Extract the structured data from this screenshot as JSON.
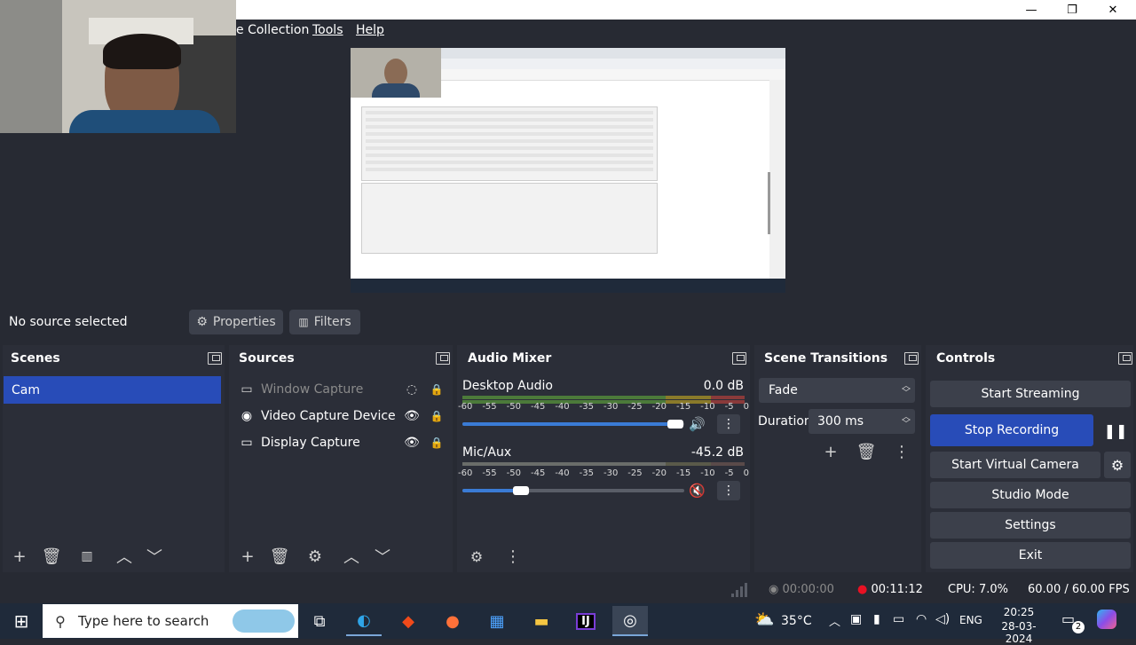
{
  "menu": {
    "items": [
      "e Collection",
      "Tools",
      "Help"
    ]
  },
  "window": {
    "minimize": "—",
    "maximize": "❐",
    "close": "✕"
  },
  "source_bar": {
    "status": "No source selected",
    "properties": "Properties",
    "filters": "Filters"
  },
  "scenes": {
    "title": "Scenes",
    "items": [
      "Cam"
    ]
  },
  "sources": {
    "title": "Sources",
    "items": [
      {
        "label": "Window Capture",
        "icon": "window-icon",
        "visible": false
      },
      {
        "label": "Video Capture Device",
        "icon": "camera-icon",
        "visible": true
      },
      {
        "label": "Display Capture",
        "icon": "monitor-icon",
        "visible": true
      }
    ]
  },
  "audio_mixer": {
    "title": "Audio Mixer",
    "ticks": [
      "-60",
      "-55",
      "-50",
      "-45",
      "-40",
      "-35",
      "-30",
      "-25",
      "-20",
      "-15",
      "-10",
      "-5",
      "0"
    ],
    "channels": [
      {
        "name": "Desktop Audio",
        "level": "0.0 dB",
        "volume": 0.94,
        "muted": false
      },
      {
        "name": "Mic/Aux",
        "level": "-45.2 dB",
        "volume": 0.26,
        "muted": true
      }
    ]
  },
  "transitions": {
    "title": "Scene Transitions",
    "type": "Fade",
    "duration_label": "Duration",
    "duration": "300 ms"
  },
  "controls": {
    "title": "Controls",
    "start_streaming": "Start Streaming",
    "stop_recording": "Stop Recording",
    "virtual_camera": "Start Virtual Camera",
    "studio_mode": "Studio Mode",
    "settings": "Settings",
    "exit": "Exit"
  },
  "status": {
    "stream_time": "00:00:00",
    "rec_time": "00:11:12",
    "cpu": "CPU: 7.0%",
    "fps": "60.00 / 60.00 FPS"
  },
  "taskbar": {
    "search_placeholder": "Type here to search",
    "temperature": "35°C",
    "language": "ENG",
    "time": "20:25",
    "date": "28-03-2024",
    "notification_count": "2"
  },
  "colors": {
    "accent": "#284cb8",
    "panel": "#2b2e38",
    "background": "#272a33",
    "record_red": "#e81123"
  }
}
